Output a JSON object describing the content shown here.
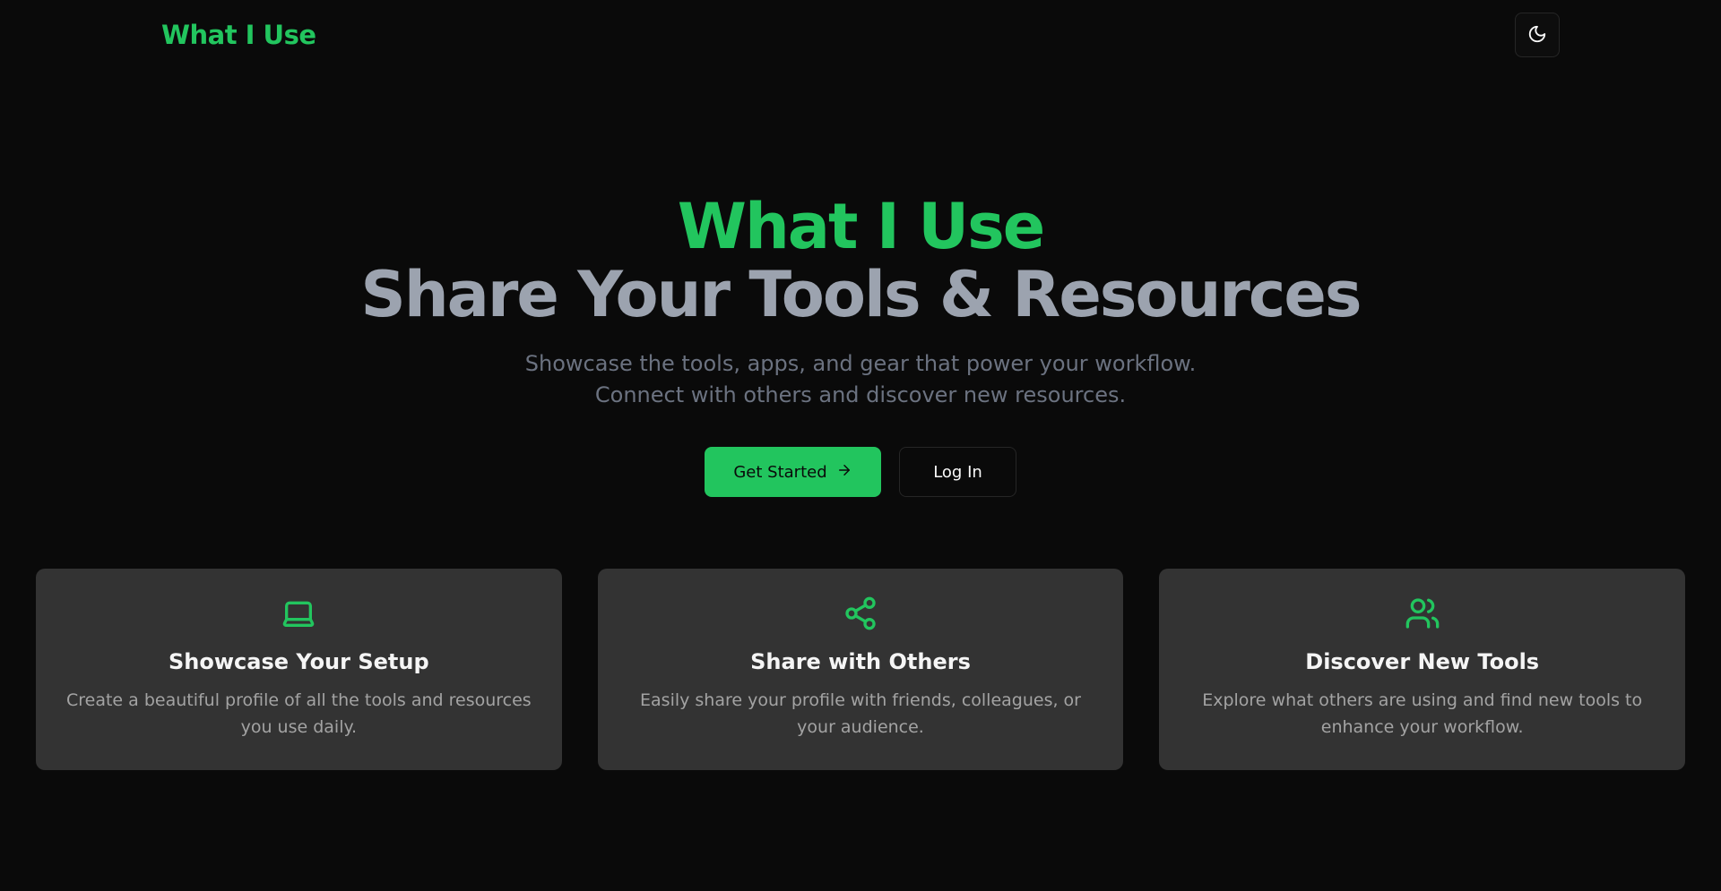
{
  "header": {
    "brand": "What I Use",
    "theme_toggle_icon": "moon-icon"
  },
  "hero": {
    "title_accent": "What I Use",
    "title_main": "Share Your Tools & Resources",
    "subtitle_line1": "Showcase the tools, apps, and gear that power your workflow.",
    "subtitle_line2": "Connect with others and discover new resources.",
    "primary_button": "Get Started",
    "primary_button_icon": "arrow-right-icon",
    "secondary_button": "Log In"
  },
  "features": [
    {
      "icon": "laptop-icon",
      "title": "Showcase Your Setup",
      "description": "Create a beautiful profile of all the tools and resources you use daily."
    },
    {
      "icon": "share-icon",
      "title": "Share with Others",
      "description": "Easily share your profile with friends, colleagues, or your audience."
    },
    {
      "icon": "users-icon",
      "title": "Discover New Tools",
      "description": "Explore what others are using and find new tools to enhance your workflow."
    }
  ],
  "colors": {
    "accent": "#22c55e",
    "background": "#0a0a0a",
    "card": "#333333",
    "heading_muted": "#9ca3af"
  }
}
